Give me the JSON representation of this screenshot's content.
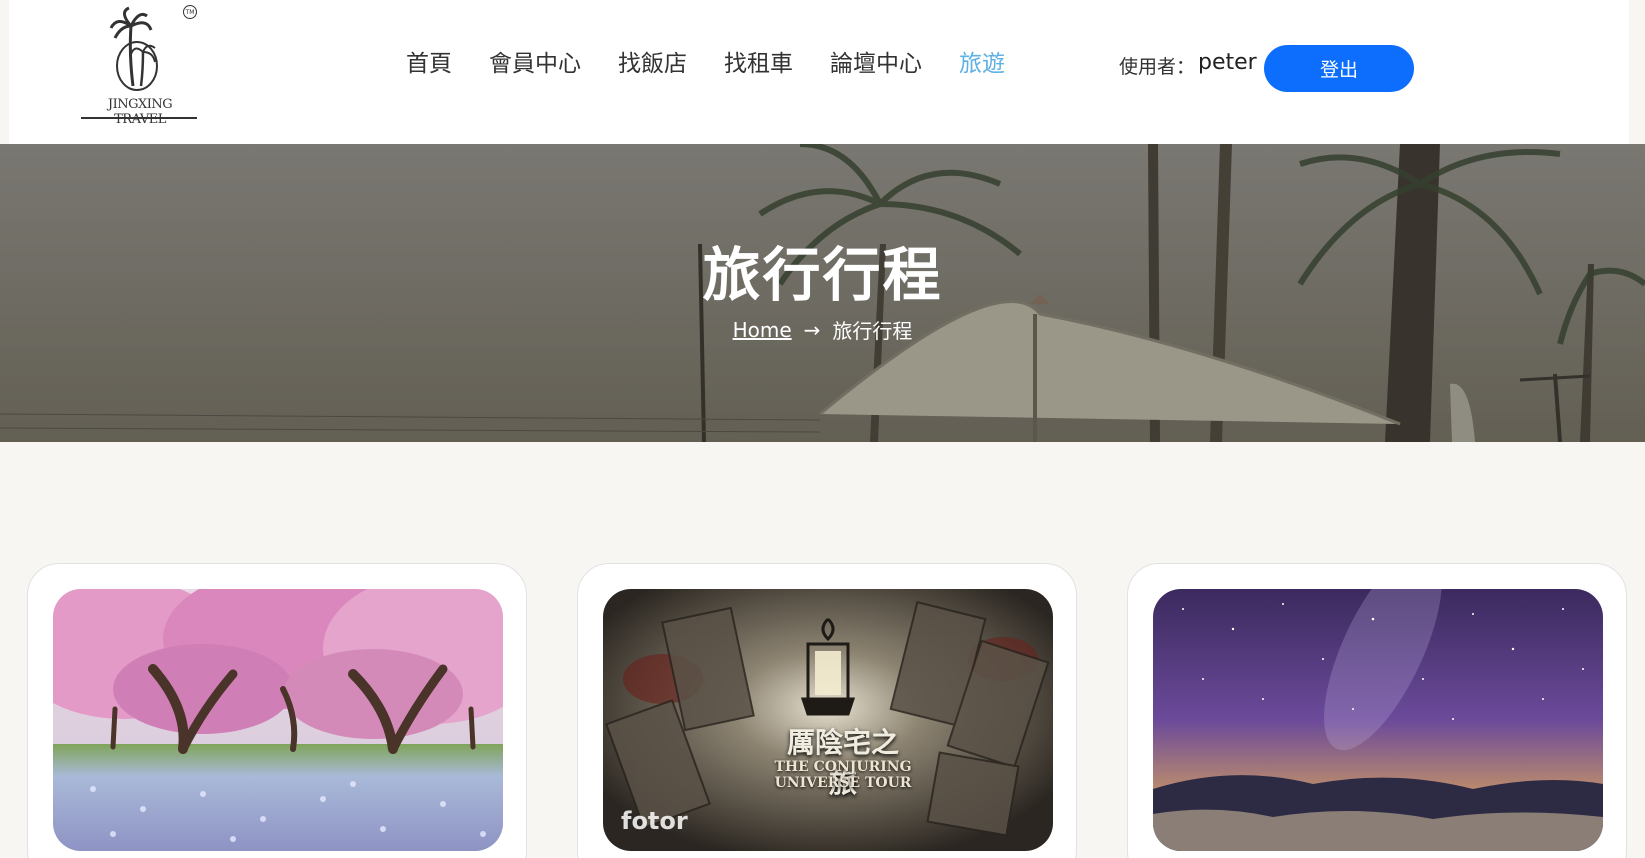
{
  "header": {
    "logo_text": "JINGXING TRAVEL",
    "logo_tm": "TM",
    "nav": [
      {
        "label": "首頁",
        "active": false
      },
      {
        "label": "會員中心",
        "active": false
      },
      {
        "label": "找飯店",
        "active": false
      },
      {
        "label": "找租車",
        "active": false
      },
      {
        "label": "論壇中心",
        "active": false
      },
      {
        "label": "旅遊",
        "active": true
      }
    ],
    "user_label": "使用者：",
    "user_name": "peter",
    "logout_label": "登出"
  },
  "hero": {
    "title": "旅行行程",
    "breadcrumb_home": "Home",
    "breadcrumb_arrow": "→",
    "breadcrumb_current": "旅行行程"
  },
  "cards": [
    {
      "image": "cherry-blossom-trees"
    },
    {
      "image": "conjuring-universe-tour",
      "caption": "厲陰宅之旅",
      "subcaption": "THE CONJURING UNIVERSE TOUR",
      "watermark": "fotor"
    },
    {
      "image": "starry-night-sky-over-mountains"
    }
  ],
  "colors": {
    "accent": "#0d6efd",
    "nav_active": "#5fb0e4",
    "page_background": "#f8f6f2"
  }
}
